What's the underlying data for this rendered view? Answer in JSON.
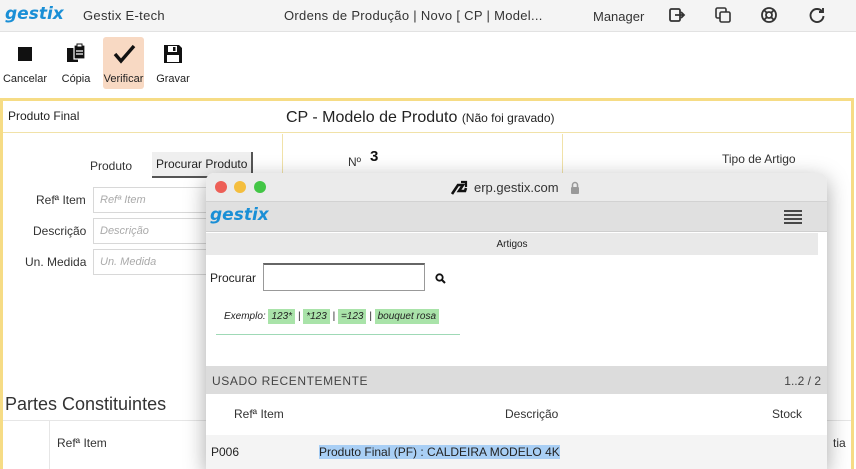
{
  "topbar": {
    "logo": "gestix",
    "app_name": "Gestix E-tech",
    "document_title": "Ordens de Produção | Novo [ CP | Model...",
    "user": "Manager"
  },
  "toolbar": {
    "cancel_label": "Cancelar",
    "copy_label": "Cópia",
    "verify_label": "Verificar",
    "save_label": "Gravar"
  },
  "card": {
    "label": "Produto Final",
    "title": "CP - Modelo de Produto",
    "title_note": "(Não foi gravado)",
    "produto_label": "Produto",
    "procurar_produto_button": "Procurar Produto",
    "ref_label": "Refª Item",
    "ref_placeholder": "Refª Item",
    "descricao_label": "Descrição",
    "descricao_placeholder": "Descrição",
    "unidade_label": "Un. Medida",
    "unidade_placeholder": "Un. Medida",
    "numero_label": "Nº",
    "numero_value": "3",
    "tipo_artigo_label": "Tipo de Artigo",
    "partes_title": "Partes Constituintes",
    "partes_ref_header": "Refª Item",
    "partes_qty_header_partial": "tia"
  },
  "popup": {
    "url": "erp.gestix.com",
    "logo": "gestix",
    "section_title": "Artigos",
    "search_label": "Procurar",
    "search_value": "",
    "example_label": "Exemplo:",
    "examples": [
      "123*",
      "*123",
      "=123",
      "bouquet rosa"
    ],
    "recent_title": "USADO RECENTEMENTE",
    "recent_pagination": "1..2 / 2",
    "columns": [
      "Refª Item",
      "Descrição",
      "Stock"
    ],
    "rows": [
      {
        "ref": "P006",
        "descricao": "Produto Final (PF) : CALDEIRA MODELO 4K",
        "stock": ""
      }
    ]
  },
  "colors": {
    "accent_blue": "#1a8fd6",
    "card_border": "#f6dc85",
    "active_tool": "#f8d9c3",
    "chip_green": "#a9e3a9",
    "selection_blue": "#a9cff5"
  }
}
